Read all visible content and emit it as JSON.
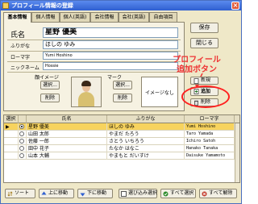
{
  "window": {
    "title": "プロフィール情報の登録"
  },
  "tabs": [
    "基本情報",
    "個人情報",
    "個人(英語)",
    "会社情報",
    "会社(英語)",
    "自由項目"
  ],
  "form": {
    "name_label": "氏名",
    "name_value": "星野 優美",
    "kana_label": "ふりがな",
    "kana_value": "ほしの ゆみ",
    "romaji_label": "ローマ字",
    "romaji_value": "Yumi Hoshino",
    "nickname_label": "ニックネーム",
    "nickname_value": "Hossie",
    "face_label": "顔イメージ",
    "mark_label": "マーク",
    "select_label": "選択...",
    "delete_label": "削除",
    "no_image_label": "イメージなし"
  },
  "side_buttons": {
    "save": "保存",
    "close": "閉じる",
    "new": "新規",
    "add": "追加",
    "delete": "削除"
  },
  "callout": {
    "line1": "プロフィール",
    "line2": "追加ボタン"
  },
  "table": {
    "headers": [
      "選択",
      "氏名",
      "ふりがな",
      "ローマ字"
    ],
    "rows": [
      {
        "name": "星野 優美",
        "kana": "ほしの ゆみ",
        "romaji": "Yumi Hoshino",
        "selected": true
      },
      {
        "name": "山田 太郎",
        "kana": "やまだ たろう",
        "romaji": "Taro Yamada",
        "selected": false
      },
      {
        "name": "佐藤 一郎",
        "kana": "さとう いちろう",
        "romaji": "Ichiro Satoh",
        "selected": false
      },
      {
        "name": "田中 花子",
        "kana": "たなか はなこ",
        "romaji": "Hanako Tanaka",
        "selected": false
      },
      {
        "name": "山本 大輔",
        "kana": "やまもと だいすけ",
        "romaji": "Daisuke Yamamoto",
        "selected": false
      }
    ]
  },
  "bottom": {
    "sort": "ソート",
    "up": "上に移動",
    "down": "下に移動",
    "multi": "選び込み選択",
    "select_all": "すべて選択",
    "deselect_all": "すべて解除"
  },
  "colors": {
    "accent_red": "#ff2020",
    "title_blue": "#2f5fd0",
    "selected_row": "#f7d35e"
  }
}
